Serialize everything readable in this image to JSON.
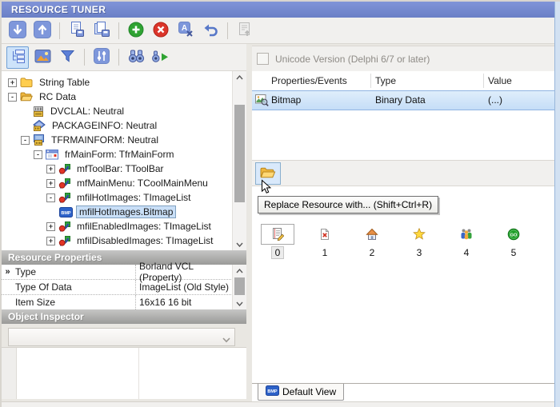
{
  "window": {
    "title": "RESOURCE TUNER"
  },
  "glyphs": {
    "plus": "+",
    "minus": "-",
    "marker": "»",
    "bmp": "BMP",
    "go": "GO"
  },
  "toolbar_main": {
    "icons": [
      "move-down-icon",
      "move-up-icon",
      "export-resource-icon",
      "export-all-icon",
      "add-resource-icon",
      "delete-resource-icon",
      "rename-resource-icon",
      "undo-icon",
      "import-resources-icon"
    ]
  },
  "toolbar_view": {
    "icons": [
      "tree-view-icon",
      "image-view-icon",
      "filter-icon",
      "options-icon",
      "find-icon",
      "find-next-icon"
    ],
    "selected": "tree-view-icon"
  },
  "tree": {
    "items": [
      {
        "label": "String Table",
        "icon": "folder-closed-icon",
        "expander": "plus"
      },
      {
        "label": "RC Data",
        "icon": "folder-open-icon",
        "expander": "minus"
      },
      {
        "label": "DVCLAL: Neutral",
        "icon": "binary-resource-icon"
      },
      {
        "label": "PACKAGEINFO: Neutral",
        "icon": "package-resource-icon"
      },
      {
        "label": "TFRMAINFORM: Neutral",
        "icon": "binary-form-icon",
        "expander": "minus"
      },
      {
        "label": "frMainForm: TfrMainForm",
        "icon": "form-icon",
        "expander": "minus"
      },
      {
        "label": "mfToolBar: TToolBar",
        "icon": "component-icon",
        "expander": "plus"
      },
      {
        "label": "mfMainMenu: TCoolMainMenu",
        "icon": "component-icon",
        "expander": "plus"
      },
      {
        "label": "mfilHotImages: TImageList",
        "icon": "component-icon",
        "expander": "minus"
      },
      {
        "label": "mfilHotImages.Bitmap",
        "icon": "bmp-icon",
        "selected": true
      },
      {
        "label": "mfilEnabledImages: TImageList",
        "icon": "component-icon",
        "expander": "plus"
      },
      {
        "label": "mfilDisabledImages: TImageList",
        "icon": "component-icon",
        "expander": "plus"
      }
    ]
  },
  "resource_properties": {
    "title": "Resource Properties",
    "rows": [
      {
        "name": "Type",
        "value": "Borland VCL (Property)"
      },
      {
        "name": "Type Of Data",
        "value": "ImageList (Old Style)"
      },
      {
        "name": "Item Size",
        "value": "16x16  16 bit"
      }
    ]
  },
  "object_inspector": {
    "title": "Object Inspector"
  },
  "right": {
    "unicode_label": "Unicode Version (Delphi 6/7 or later)",
    "unicode_checked": false,
    "table": {
      "columns": [
        "Properties/Events",
        "Type",
        "Value"
      ],
      "row": {
        "property": "Bitmap",
        "type": "Binary Data",
        "value": "(...)"
      },
      "selected_row": "Bitmap"
    },
    "replace_button_icon": "open-folder-icon",
    "tooltip": "Replace Resource with... (Shift+Ctrl+R)",
    "images": {
      "items": [
        {
          "label": "0",
          "icon": "note-edit-icon",
          "selected": true
        },
        {
          "label": "1",
          "icon": "delete-doc-icon"
        },
        {
          "label": "2",
          "icon": "home-icon"
        },
        {
          "label": "3",
          "icon": "star-icon"
        },
        {
          "label": "4",
          "icon": "users-icon"
        },
        {
          "label": "5",
          "icon": "go-icon"
        }
      ]
    },
    "tab_label": "Default View"
  },
  "colors": {
    "titlebar": "#7389CF",
    "tree_selection": "#C9DFF7",
    "row_selection": "#CBE2F8",
    "accent_green": "#2FA332",
    "accent_red": "#DB352A",
    "folder_yellow": "#FFCE4F"
  }
}
